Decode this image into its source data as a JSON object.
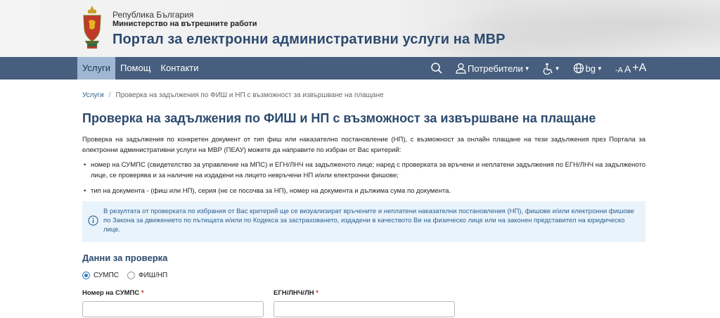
{
  "header": {
    "republic": "Република България",
    "ministry": "Министерство на вътрешните работи",
    "portal_title": "Портал за електронни административни услуги на МВР"
  },
  "nav": {
    "items": [
      {
        "label": "Услуги",
        "active": true
      },
      {
        "label": "Помощ",
        "active": false
      },
      {
        "label": "Контакти",
        "active": false
      }
    ],
    "users_label": "Потребители",
    "lang_label": "bg",
    "font_sizes": [
      "-A",
      "A",
      "+A"
    ]
  },
  "breadcrumb": {
    "home": "Услуги",
    "separator": "/",
    "current": "Проверка на задължения по ФИШ и НП с възможност за извършване на плащане"
  },
  "page": {
    "title": "Проверка на задължения по ФИШ и НП с възможност за извършване на плащане",
    "intro": "Проверка на задължения по конкретен документ от тип фиш или наказателно постановление (НП), с възможност за онлайн плащане на тези задължения през Портала за електронни административни услуги на МВР (ПЕАУ) можете да направите по избран от Вас критерий:",
    "bullets": [
      "номер на СУМПС (свидетелство за управление на МПС) и ЕГН/ЛНЧ на задълженото лице;  наред с проверката за връчени и неплатени задължения по ЕГН/ЛНЧ на задълженото лице, се проверява и за наличие на издадени на лицето невръчени НП и/или електронни фишове;",
      "тип на документа - (фиш или НП), серия (не се посочва за НП), номер на документа и дължима сума по документа."
    ],
    "info": "В резултата от проверката по избрания от Вас критерий ще се визуализират връчените и неплатени наказателни постановления (НП), фишове и/или електронни фишове по Закона за движението по пътищата и/или по Кодекса за застраховането, издадени в качеството Ви на физическо лице или на законен представител на юридическо лице."
  },
  "form": {
    "section_title": "Данни за проверка",
    "radios": [
      {
        "label": "СУМПС",
        "checked": true
      },
      {
        "label": "ФИШ/НП",
        "checked": false
      }
    ],
    "fields": [
      {
        "label": "Номер на СУМПС",
        "required": "*",
        "value": ""
      },
      {
        "label": "ЕГН/ЛНЧ/ЛН",
        "required": "*",
        "value": ""
      }
    ]
  },
  "colors": {
    "navbar": "#475e7e",
    "nav_active": "#9fb7d3",
    "title": "#2c4a6e",
    "info_bg": "#e9f3fb",
    "radio_accent": "#2c78c5"
  },
  "icons": [
    "coat-of-arms-logo",
    "search-icon",
    "user-icon",
    "accessibility-icon",
    "globe-icon",
    "info-icon"
  ]
}
